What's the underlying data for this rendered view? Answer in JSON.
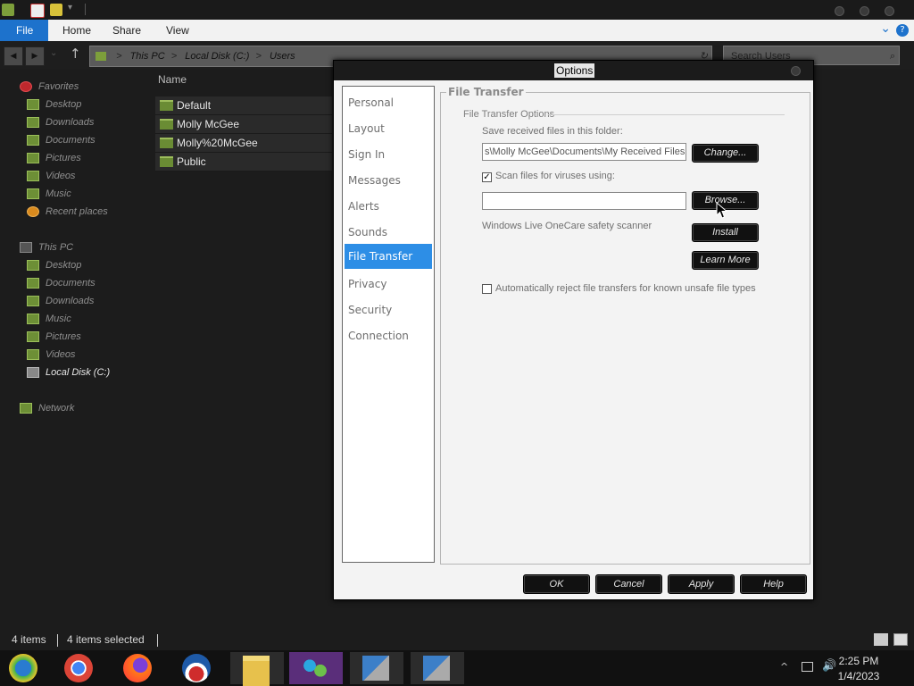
{
  "explorer": {
    "ribbon": {
      "file": "File",
      "home": "Home",
      "share": "Share",
      "view": "View"
    },
    "breadcrumb": [
      "This PC",
      "Local Disk (C:)",
      "Users"
    ],
    "breadcrumb_sep": ">",
    "search_placeholder": "Search Users",
    "column_header": "Name",
    "favorites": {
      "title": "Favorites",
      "items": [
        "Desktop",
        "Downloads",
        "Documents",
        "Pictures",
        "Videos",
        "Music",
        "Recent places"
      ]
    },
    "this_pc": {
      "title": "This PC",
      "items": [
        "Desktop",
        "Documents",
        "Downloads",
        "Music",
        "Pictures",
        "Videos",
        "Local Disk (C:)"
      ]
    },
    "network": "Network",
    "files": [
      "Default",
      "Molly McGee",
      "Molly%20McGee",
      "Public"
    ],
    "status": {
      "count": "4 items",
      "selected": "4 items selected"
    }
  },
  "dialog": {
    "title": "Options",
    "sidebar": [
      "Personal",
      "Layout",
      "Sign In",
      "Messages",
      "Alerts",
      "Sounds",
      "File Transfer",
      "Privacy",
      "Security",
      "Connection"
    ],
    "active_index": 6,
    "group_title": "File Transfer",
    "sub_title": "File Transfer Options",
    "save_label": "Save received files in this folder:",
    "save_path": "s\\Molly McGee\\Documents\\My Received Files",
    "change_button": "Change...",
    "scan_label": "Scan files for viruses using:",
    "scan_checked": true,
    "scanner_path": "",
    "browse_button": "Browse...",
    "scanner_name": "Windows Live OneCare safety scanner",
    "install_button": "Install",
    "learn_more_button": "Learn More",
    "reject_label": "Automatically reject file transfers for known unsafe file types",
    "reject_checked": false,
    "buttons": {
      "ok": "OK",
      "cancel": "Cancel",
      "apply": "Apply",
      "help": "Help"
    }
  },
  "taskbar": {
    "time": "2:25 PM",
    "date": "1/4/2023",
    "tray_chevron": "^",
    "apps": [
      "messenger-icon",
      "chrome-icon",
      "firefox-icon",
      "obama-logo-icon",
      "file-explorer-icon",
      "msn-messenger-people-icon",
      "installer-icon",
      "installer-icon"
    ]
  },
  "colors": {
    "accent": "#2d8ee6",
    "ribbon_file": "#1d72cc",
    "folder_green": "#6d8f36"
  }
}
